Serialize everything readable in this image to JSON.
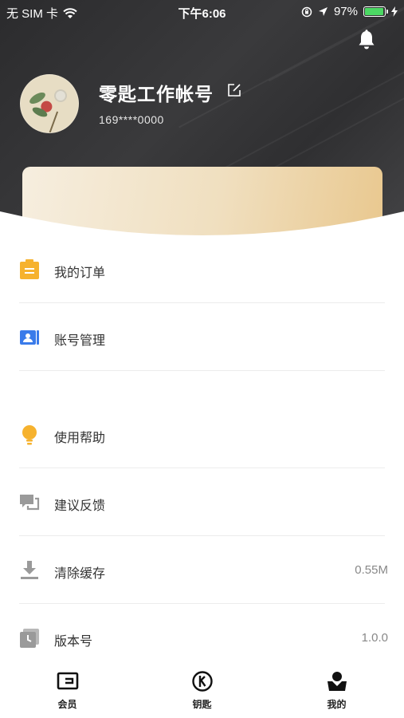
{
  "status_bar": {
    "carrier": "无 SIM 卡",
    "time": "下午6:06",
    "battery": "97%",
    "battery_level": 0.97,
    "icons": [
      "wifi-icon",
      "orientation-lock-icon",
      "location-arrow-icon",
      "battery-icon",
      "charging-icon"
    ]
  },
  "profile": {
    "name": "零匙工作帐号",
    "phone": "169****0000"
  },
  "menu": {
    "items": [
      {
        "label": "我的订单",
        "icon": "order-icon",
        "color": "#f6b22e"
      },
      {
        "label": "账号管理",
        "icon": "account-card-icon",
        "color": "#3a7bea"
      },
      {
        "label": "使用帮助",
        "icon": "lightbulb-icon",
        "color": "#f6b22e"
      },
      {
        "label": "建议反馈",
        "icon": "feedback-icon",
        "color": "#9a9a9a"
      },
      {
        "label": "清除缓存",
        "icon": "download-icon",
        "color": "#9a9a9a",
        "value": "0.55M"
      },
      {
        "label": "版本号",
        "icon": "version-icon",
        "color": "#9a9a9a",
        "value": "1.0.0"
      }
    ]
  },
  "tabbar": {
    "tabs": [
      {
        "label": "会员",
        "icon": "membership-card-icon"
      },
      {
        "label": "钥匙",
        "icon": "key-logo-icon"
      },
      {
        "label": "我的",
        "icon": "profile-icon",
        "active": true
      }
    ]
  },
  "colors": {
    "header_dark": "#2f2f31",
    "gold": "#e9c88f",
    "accent_yellow": "#f6b22e",
    "accent_blue": "#3a7bea"
  }
}
